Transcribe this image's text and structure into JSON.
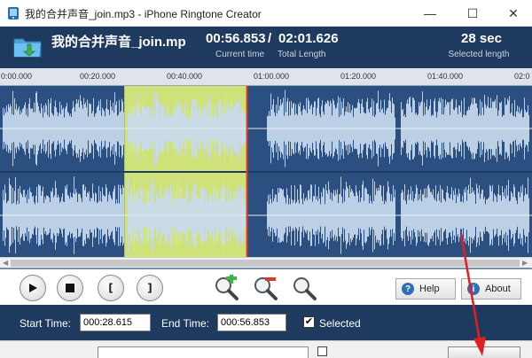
{
  "window": {
    "title": "我的合并声音_join.mp3 - iPhone Ringtone Creator",
    "minimize_glyph": "—",
    "maximize_glyph": "☐",
    "close_glyph": "✕"
  },
  "header": {
    "filename": "我的合并声音_join.mp",
    "current_time": "00:56.853",
    "separator": "/",
    "total_length": "02:01.626",
    "current_time_caption": "Current time",
    "total_length_caption": "Total Length",
    "selected_length": "28 sec",
    "selected_length_caption": "Selected length"
  },
  "ruler": {
    "ticks": [
      "0:00.000",
      "00:20.000",
      "00:40.000",
      "01:00.000",
      "01:20.000",
      "01:40.000",
      "02:0"
    ]
  },
  "waveform": {
    "total_seconds": 121.626,
    "selection_start_seconds": 28.615,
    "selection_end_seconds": 56.853,
    "cursor_seconds": 56.853,
    "colors": {
      "background": "#2b4f80",
      "wave": "#c9dbee",
      "selection": "#cfe27a",
      "cursor": "#e03a1e"
    }
  },
  "controls": {
    "play_icon": "play-icon",
    "stop_icon": "stop-icon",
    "set_start_glyph": "[",
    "set_end_glyph": "]",
    "help_label": "Help",
    "about_label": "About"
  },
  "time_panel": {
    "start_time_label": "Start Time:",
    "start_time_value": "000:28.615",
    "end_time_label": "End Time:",
    "end_time_value": "000:56.853",
    "selected_checked": true,
    "selected_label": "Selected"
  },
  "colors": {
    "header_bg": "#1f3a5f",
    "annotation_arrow": "#e02020"
  }
}
